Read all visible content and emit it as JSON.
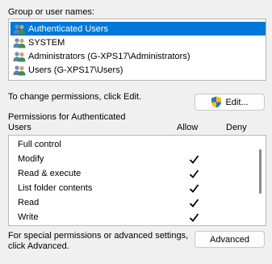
{
  "group_label": "Group or user names:",
  "groups": [
    {
      "name": "Authenticated Users",
      "selected": true
    },
    {
      "name": "SYSTEM",
      "selected": false
    },
    {
      "name": "Administrators (G-XPS17\\Administrators)",
      "selected": false
    },
    {
      "name": "Users (G-XPS17\\Users)",
      "selected": false
    }
  ],
  "change_hint": "To change permissions, click Edit.",
  "edit_button": "Edit...",
  "permissions_header": {
    "line1": "Permissions for Authenticated",
    "line2": "Users",
    "allow": "Allow",
    "deny": "Deny"
  },
  "permissions": [
    {
      "name": "Full control",
      "allow": false,
      "deny": false
    },
    {
      "name": "Modify",
      "allow": true,
      "deny": false
    },
    {
      "name": "Read & execute",
      "allow": true,
      "deny": false
    },
    {
      "name": "List folder contents",
      "allow": true,
      "deny": false
    },
    {
      "name": "Read",
      "allow": true,
      "deny": false
    },
    {
      "name": "Write",
      "allow": true,
      "deny": false
    }
  ],
  "advanced_hint": {
    "line1": "For special permissions or advanced settings,",
    "line2": "click Advanced."
  },
  "advanced_button": "Advanced",
  "colors": {
    "selection": "#0078d7",
    "background": "#f0f0f0"
  },
  "icons": {
    "user_group": "users-icon",
    "shield": "uac-shield-icon",
    "check": "checkmark-icon"
  }
}
